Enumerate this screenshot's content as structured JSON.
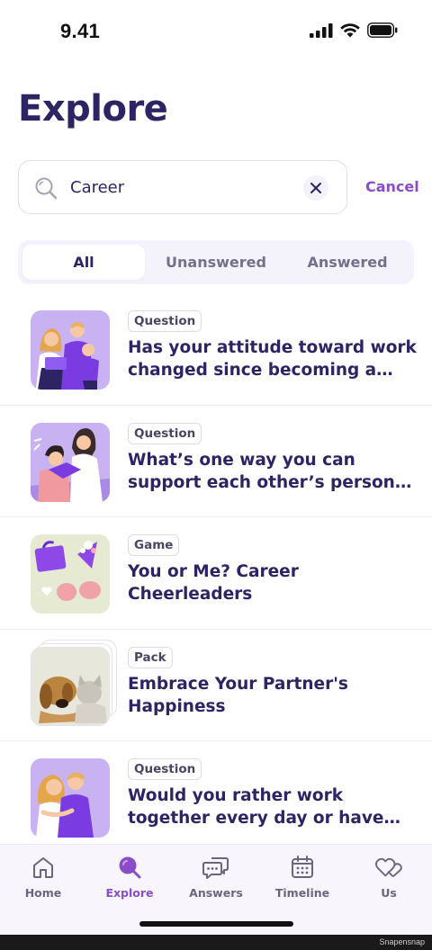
{
  "status": {
    "time": "9.41"
  },
  "header": {
    "title": "Explore"
  },
  "search": {
    "value": "Career",
    "cancel_label": "Cancel"
  },
  "filters": [
    {
      "label": "All",
      "active": true
    },
    {
      "label": "Unanswered",
      "active": false
    },
    {
      "label": "Answered",
      "active": false
    }
  ],
  "results": [
    {
      "tag": "Question",
      "title": "Has your attitude toward work changed since becoming a parent?",
      "thumb": "family-illustration"
    },
    {
      "tag": "Question",
      "title": "What’s one way you can support each other’s personal and career goals?",
      "thumb": "couple-reading-illustration"
    },
    {
      "tag": "Game",
      "title": "You or Me? Career Cheerleaders",
      "thumb": "briefcase-pompom-illustration"
    },
    {
      "tag": "Pack",
      "title": "Embrace Your Partner's Happiness",
      "thumb": "puppy-kitten-photo"
    },
    {
      "tag": "Question",
      "title": "Would you rather work together every day or have totally separate careers?",
      "thumb": "couple-hug-illustration"
    }
  ],
  "tabbar": [
    {
      "label": "Home",
      "icon": "home-icon",
      "active": false
    },
    {
      "label": "Explore",
      "icon": "explore-icon",
      "active": true
    },
    {
      "label": "Answers",
      "icon": "answers-icon",
      "active": false
    },
    {
      "label": "Timeline",
      "icon": "calendar-icon",
      "active": false
    },
    {
      "label": "Us",
      "icon": "hearts-icon",
      "active": false
    }
  ],
  "footer": {
    "watermark": "Snapensnap"
  },
  "colors": {
    "accent": "#8a4dc8",
    "title": "#2d2463",
    "purple_soft": "#c9b2f2",
    "green_soft": "#e6ead3"
  }
}
